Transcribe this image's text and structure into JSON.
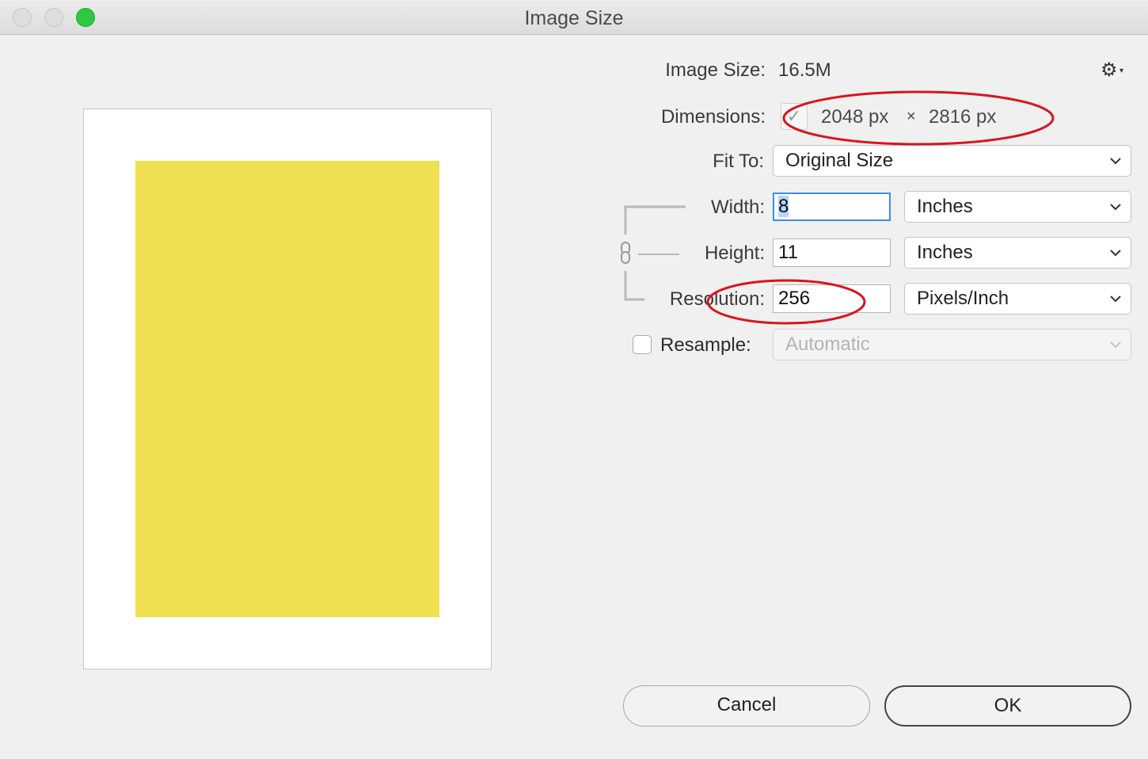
{
  "window": {
    "title": "Image Size",
    "traffic_lights": [
      "close",
      "minimize",
      "zoom"
    ]
  },
  "preview": {
    "image_color": "#f0df4e",
    "frame_color": "#ffffff"
  },
  "image_size": {
    "label": "Image Size:",
    "value": "16.5M"
  },
  "settings": {
    "icon": "gear-icon"
  },
  "dimensions": {
    "label": "Dimensions:",
    "checked": true,
    "width": "2048 px",
    "separator": "×",
    "height": "2816 px"
  },
  "fit_to": {
    "label": "Fit To:",
    "selected": "Original Size"
  },
  "width": {
    "label": "Width:",
    "value": "8",
    "unit": "Inches"
  },
  "height": {
    "label": "Height:",
    "value": "11",
    "unit": "Inches"
  },
  "resolution": {
    "label": "Resolution:",
    "value": "256",
    "unit": "Pixels/Inch"
  },
  "resample": {
    "label": "Resample:",
    "checked": false,
    "selected": "Automatic",
    "enabled": false
  },
  "buttons": {
    "cancel": "Cancel",
    "ok": "OK"
  },
  "annotations": {
    "color": "#d9141c",
    "targets": [
      "dimensions-values",
      "resolution-field"
    ]
  }
}
